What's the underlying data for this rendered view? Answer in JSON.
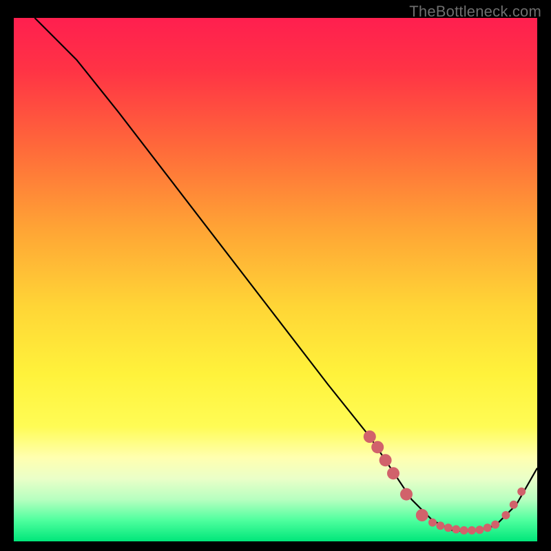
{
  "watermark": "TheBottleneck.com",
  "chart_data": {
    "type": "line",
    "title": "",
    "xlabel": "",
    "ylabel": "",
    "xlim": [
      0,
      100
    ],
    "ylim": [
      0,
      100
    ],
    "series": [
      {
        "name": "curve",
        "x": [
          4,
          8,
          12,
          20,
          30,
          40,
          50,
          60,
          68,
          72,
          76,
          80,
          84,
          88,
          92,
          96,
          100
        ],
        "y": [
          100,
          96,
          92,
          82,
          69,
          56,
          43,
          30,
          20,
          14,
          8,
          4,
          2,
          2,
          3,
          7,
          14
        ]
      }
    ],
    "markers": {
      "name": "highlight-points",
      "points": [
        {
          "x": 68,
          "y": 20
        },
        {
          "x": 69.5,
          "y": 18
        },
        {
          "x": 71,
          "y": 15.5
        },
        {
          "x": 72.5,
          "y": 13
        },
        {
          "x": 75,
          "y": 9
        },
        {
          "x": 78,
          "y": 5
        },
        {
          "x": 80,
          "y": 3.6
        },
        {
          "x": 81.5,
          "y": 3
        },
        {
          "x": 83,
          "y": 2.6
        },
        {
          "x": 84.5,
          "y": 2.3
        },
        {
          "x": 86,
          "y": 2.1
        },
        {
          "x": 87.5,
          "y": 2.1
        },
        {
          "x": 89,
          "y": 2.2
        },
        {
          "x": 90.5,
          "y": 2.6
        },
        {
          "x": 92,
          "y": 3.2
        },
        {
          "x": 94,
          "y": 5
        },
        {
          "x": 95.5,
          "y": 7
        },
        {
          "x": 97,
          "y": 9.5
        }
      ],
      "color": "#d1626b",
      "size_default": 6,
      "size_large_indices": [
        0,
        1,
        2,
        3,
        4,
        5
      ],
      "size_large": 9
    },
    "background_gradient": {
      "stops": [
        {
          "offset": 0.0,
          "color": "#ff1f4f"
        },
        {
          "offset": 0.1,
          "color": "#ff3345"
        },
        {
          "offset": 0.25,
          "color": "#ff6a3a"
        },
        {
          "offset": 0.4,
          "color": "#ffa335"
        },
        {
          "offset": 0.55,
          "color": "#ffd536"
        },
        {
          "offset": 0.68,
          "color": "#fff23b"
        },
        {
          "offset": 0.78,
          "color": "#fffc55"
        },
        {
          "offset": 0.84,
          "color": "#ffffb0"
        },
        {
          "offset": 0.88,
          "color": "#eaffc8"
        },
        {
          "offset": 0.92,
          "color": "#b7ffc0"
        },
        {
          "offset": 0.96,
          "color": "#4eff9e"
        },
        {
          "offset": 1.0,
          "color": "#00e67a"
        }
      ]
    }
  }
}
